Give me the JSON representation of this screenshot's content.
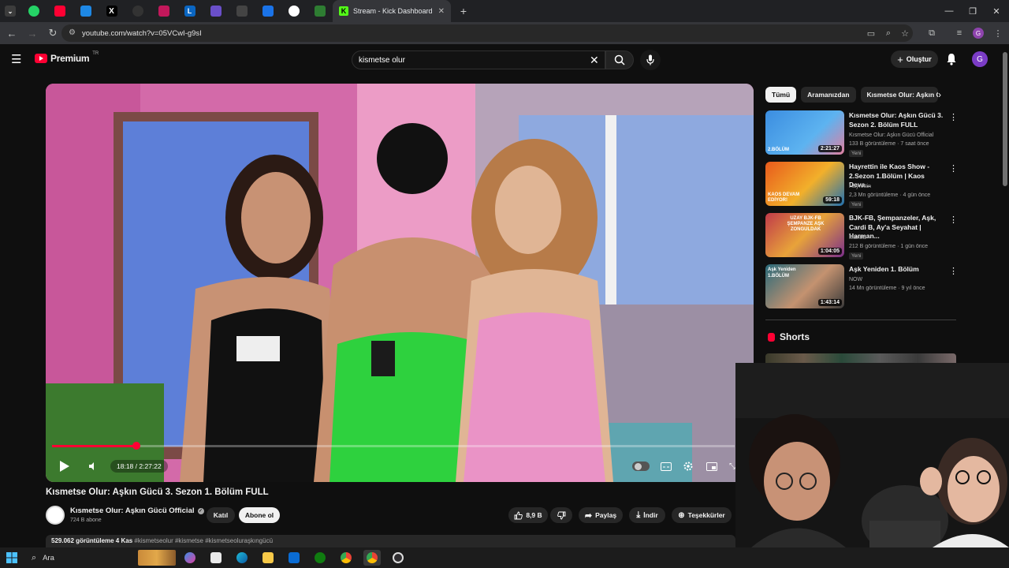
{
  "browser": {
    "active_tab": {
      "title": "Stream - Kick Dashboard"
    },
    "new_tab": "+",
    "url": "youtube.com/watch?v=05VCwI-g9sI"
  },
  "yt": {
    "logo_word": "Premium",
    "logo_region": "TR",
    "search_value": "kismetse olur",
    "create_label": "Oluştur",
    "avatar_letter": "G"
  },
  "player": {
    "time": "18:18 / 2:27:22",
    "progress": 0.124
  },
  "video": {
    "title": "Kısmetse Olur: Aşkın Gücü 3. Sezon 1. Bölüm FULL",
    "channel": "Kısmetse Olur: Aşkın Gücü Official",
    "subscribers": "724 B abone",
    "join_label": "Katıl",
    "subscribe_label": "Abone ol",
    "likes": "8,9 B",
    "share_label": "Paylaş",
    "download_label": "İndir",
    "thanks_label": "Teşekkürler",
    "views": "529.062 görüntüleme  4 Kas",
    "hashtags": "#kismetseolur #kismetse #kismetseoluraşkıngücü"
  },
  "chips": [
    "Tümü",
    "Aramanızdan",
    "Kısmetse Olur: Aşkın Gü"
  ],
  "recommendations": [
    {
      "title": "Kısmetse Olur: Aşkın Gücü 3. Sezon 2. Bölüm FULL",
      "channel": "Kısmetse Olur: Aşkın Gücü Official",
      "views": "133 B görüntüleme · 7 saat önce",
      "badge": "Yeni",
      "duration": "2:21:27",
      "thumb_label": "2.BÖLÜM"
    },
    {
      "title": "Hayrettin ile Kaos Show - 2.Sezon 1.Bölüm | Kaos Deva...",
      "channel": "Hayrettin",
      "views": "2,3 Mn görüntüleme · 4 gün önce",
      "badge": "Yeni",
      "duration": "59:18",
      "thumb_label": "KAOS DEVAM EDİYOR!"
    },
    {
      "title": "BJK-FB, Şempanzeler, Aşk, Cardi B, Ay'a Seyahat | Harman...",
      "channel": "Mantra",
      "views": "212 B görüntüleme · 1 gün önce",
      "badge": "Yeni",
      "duration": "1:04:05",
      "thumb_label": "UZAY BJK-FB ŞEMPANZE AŞK ZONGULDAK"
    },
    {
      "title": "Aşk Yeniden 1. Bölüm",
      "channel": "NOW",
      "views": "14 Mn görüntüleme · 9 yıl önce",
      "badge": "",
      "duration": "1:43:14",
      "thumb_label": "Aşk Yeniden 1.BÖLÜM"
    }
  ],
  "shorts_heading": "Shorts",
  "taskbar": {
    "search_label": "Ara"
  },
  "colors": {
    "accent": "#ff0033",
    "background": "#0f0f0f",
    "pill": "#272727"
  }
}
